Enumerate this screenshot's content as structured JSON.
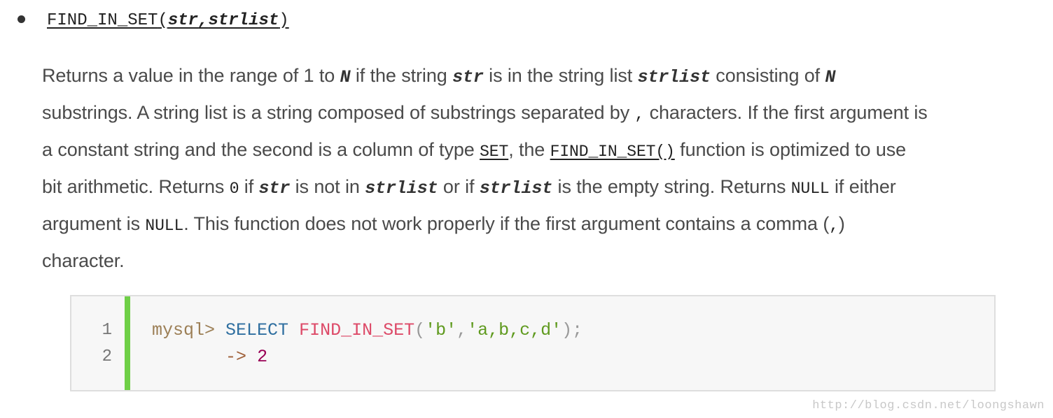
{
  "heading": {
    "func_name": "FIND_IN_SET",
    "open_paren": "(",
    "arg1": "str",
    "comma": ",",
    "arg2": "strlist",
    "close_paren": ")"
  },
  "description": {
    "l1_a": "Returns a value in the range of 1 to ",
    "l1_var_n": "N",
    "l1_b": " if the string ",
    "l1_var_str": "str",
    "l1_c": " is in the string list ",
    "l1_var_strlist": "strlist",
    "l1_d": " consisting of ",
    "l1_var_n2": "N",
    "l2_a": "substrings. A string list is a string composed of substrings separated by ",
    "l2_code": ",",
    "l2_b": " characters. If the first argument is",
    "l3_a": "a constant string and the second is a column of type ",
    "l3_link_set": "SET",
    "l3_b": ", the ",
    "l3_link_func": "FIND_IN_SET()",
    "l3_c": " function is optimized to use",
    "l4_a": "bit arithmetic. Returns ",
    "l4_code_zero": "0",
    "l4_b": " if ",
    "l4_var_str": "str",
    "l4_c": " is not in ",
    "l4_var_strlist": "strlist",
    "l4_d": " or if ",
    "l4_var_strlist2": "strlist",
    "l4_e": " is the empty string. Returns ",
    "l4_code_null": "NULL",
    "l4_f": " if either",
    "l5_a": "argument is ",
    "l5_code_null": "NULL",
    "l5_b": ". This function does not work properly if the first argument contains a comma (",
    "l5_code_comma": ",",
    "l5_c": ")",
    "l6_a": "character."
  },
  "code": {
    "line_numbers": [
      "1",
      "2"
    ],
    "line1": {
      "prompt": "mysql>",
      "keyword": "SELECT",
      "func": "FIND_IN_SET",
      "open": "(",
      "arg1": "'b'",
      "sep": ",",
      "arg2": "'a,b,c,d'",
      "close": ");"
    },
    "line2": {
      "arrow": "->",
      "result": "2"
    },
    "accent_color": "#6fcf47"
  },
  "watermark": "http://blog.csdn.net/loongshawn"
}
